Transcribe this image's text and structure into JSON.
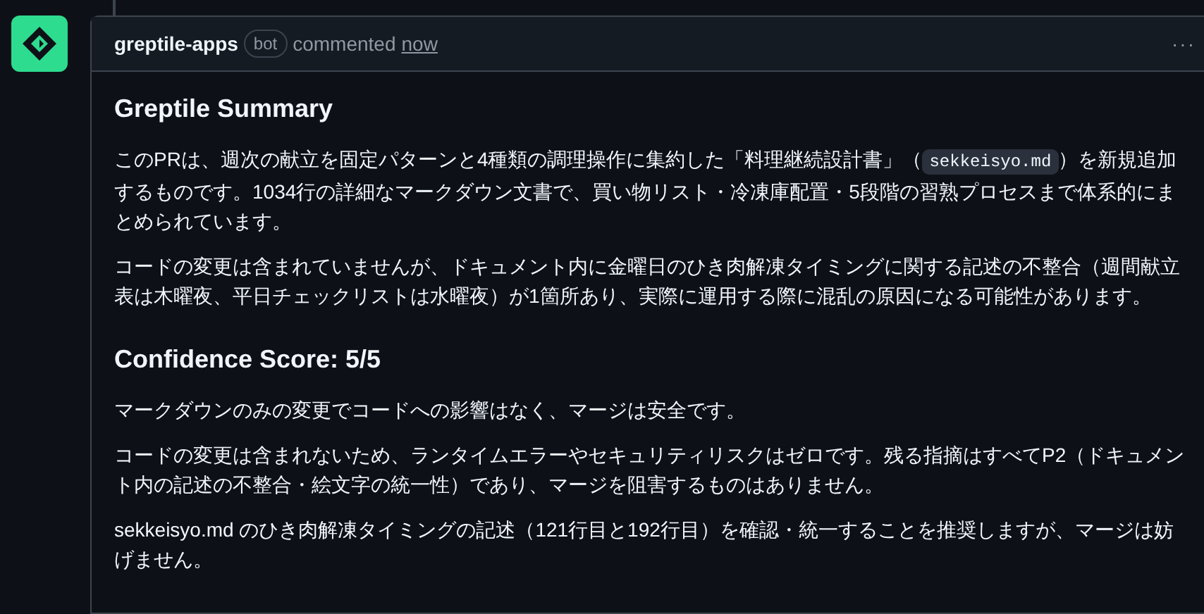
{
  "comment": {
    "author": "greptile-apps",
    "badge": "bot",
    "action": "commented",
    "time": "now",
    "menu": "···",
    "sections": [
      {
        "heading": "Greptile Summary",
        "paragraphs": [
          {
            "before": "このPRは、週次の献立を固定パターンと4種類の調理操作に集約した「料理継続設計書」（",
            "code": "sekkeisyo.md",
            "after": "）を新規追加するものです。1034行の詳細なマークダウン文書で、買い物リスト・冷凍庫配置・5段階の習熟プロセスまで体系的にまとめられています。"
          },
          {
            "before": "コードの変更は含まれていませんが、ドキュメント内に金曜日のひき肉解凍タイミングに関する記述の不整合（週間献立表は木曜夜、平日チェックリストは水曜夜）が1箇所あり、実際に運用する際に混乱の原因になる可能性があります。"
          }
        ]
      },
      {
        "heading": "Confidence Score: 5/5",
        "paragraphs": [
          {
            "before": "マークダウンのみの変更でコードへの影響はなく、マージは安全です。"
          },
          {
            "before": "コードの変更は含まれないため、ランタイムエラーやセキュリティリスクはゼロです。残る指摘はすべてP2（ドキュメント内の記述の不整合・絵文字の統一性）であり、マージを阻害するものはありません。"
          },
          {
            "before": "sekkeisyo.md のひき肉解凍タイミングの記述（121行目と192行目）を確認・統一することを推奨しますが、マージは妨げません。"
          }
        ]
      }
    ]
  }
}
